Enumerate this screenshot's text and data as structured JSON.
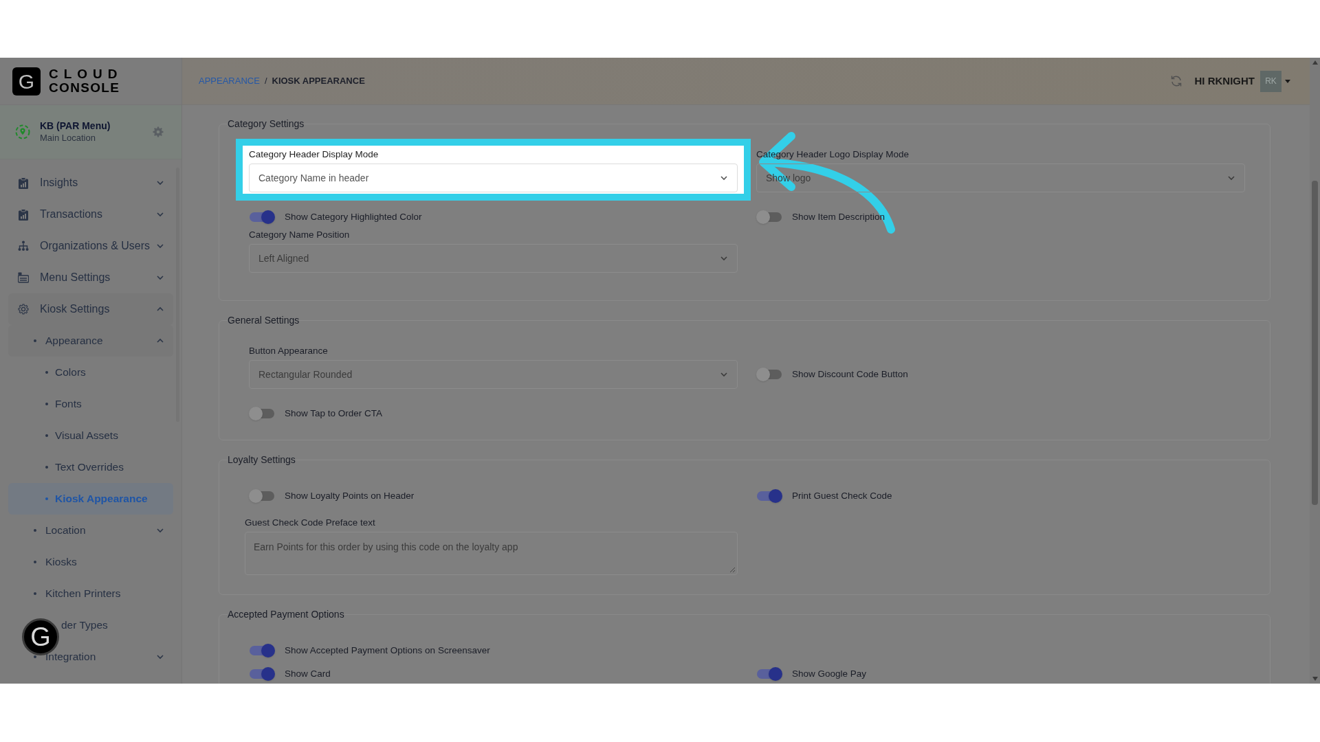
{
  "logo": {
    "mark": "G",
    "line1": "CLOUD",
    "line2": "CONSOLE"
  },
  "location": {
    "name": "KB (PAR Menu)",
    "subtitle": "Main Location"
  },
  "nav": [
    {
      "label": "Insights",
      "expanded": false,
      "selected": false
    },
    {
      "label": "Transactions",
      "expanded": false,
      "selected": false
    },
    {
      "label": "Organizations & Users",
      "expanded": false,
      "selected": false
    },
    {
      "label": "Menu Settings",
      "expanded": false,
      "selected": false
    },
    {
      "label": "Kiosk Settings",
      "expanded": true,
      "selected": false,
      "children": [
        {
          "label": "Appearance",
          "expanded": true,
          "selected": false,
          "children": [
            {
              "label": "Colors",
              "selected": false
            },
            {
              "label": "Fonts",
              "selected": false
            },
            {
              "label": "Visual Assets",
              "selected": false
            },
            {
              "label": "Text Overrides",
              "selected": false
            },
            {
              "label": "Kiosk Appearance",
              "selected": true
            }
          ]
        },
        {
          "label": "Location",
          "expanded": false,
          "selected": false
        },
        {
          "label": "Kiosks",
          "selected": false
        },
        {
          "label": "Kitchen Printers",
          "selected": false
        },
        {
          "label": "der Types",
          "selected": false
        },
        {
          "label": "Integration",
          "expanded": false,
          "selected": false
        }
      ]
    }
  ],
  "help_button": {
    "mark": "G"
  },
  "breadcrumb": {
    "items": [
      "APPEARANCE",
      "KIOSK APPEARANCE"
    ],
    "separator": "/"
  },
  "user": {
    "greeting": "HI RKNIGHT",
    "initials": "RK"
  },
  "sections": [
    {
      "title": "Category Settings",
      "rows": [
        [
          {
            "kind": "select",
            "label": "Category Header Display Mode",
            "value": "Category Name in header",
            "highlighted": true
          },
          {
            "kind": "select",
            "label": "Category Header Logo Display Mode",
            "value": "Show logo",
            "highlighted": false
          }
        ],
        [
          {
            "kind": "toggle",
            "label": "Show Category Highlighted Color",
            "on": true
          },
          {
            "kind": "toggle",
            "label": "Show Item Description",
            "on": false
          }
        ],
        [
          {
            "kind": "select",
            "label": "Category Name Position",
            "value": "Left Aligned",
            "highlighted": false
          }
        ]
      ]
    },
    {
      "title": "General Settings",
      "rows": [
        [
          {
            "kind": "select",
            "label": "Button Appearance",
            "value": "Rectangular Rounded",
            "highlighted": false
          },
          {
            "kind": "toggle",
            "label": "Show Discount Code Button",
            "on": false
          }
        ],
        [
          {
            "kind": "toggle",
            "label": "Show Tap to Order CTA",
            "on": false
          }
        ]
      ]
    },
    {
      "title": "Loyalty Settings",
      "rows": [
        [
          {
            "kind": "toggle",
            "label": "Show Loyalty Points on Header",
            "on": false
          },
          {
            "kind": "toggle",
            "label": "Print Guest Check Code",
            "on": true
          }
        ],
        [
          {
            "kind": "textarea",
            "label": "Guest Check Code Preface text",
            "value": "Earn Points for this order by using this code on the loyalty app"
          }
        ]
      ]
    },
    {
      "title": "Accepted Payment Options",
      "rows": [
        [
          {
            "kind": "toggle",
            "label": "Show Accepted Payment Options on Screensaver",
            "on": true
          }
        ],
        [
          {
            "kind": "toggle",
            "label": "Show Card",
            "on": true
          },
          {
            "kind": "toggle",
            "label": "Show Google Pay",
            "on": true
          }
        ]
      ]
    }
  ]
}
